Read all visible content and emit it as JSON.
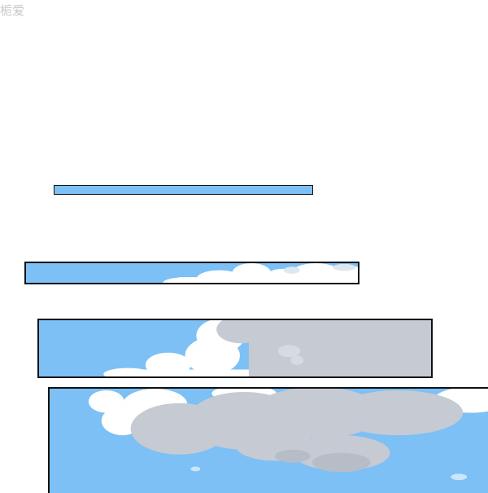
{
  "watermark": {
    "text": "栀爱"
  },
  "panels": [
    {
      "name": "sky-strip-thin"
    },
    {
      "name": "sky-strip-clouds-small"
    },
    {
      "name": "sky-strip-clouds-large"
    },
    {
      "name": "sky-strip-clouds-full"
    }
  ],
  "colors": {
    "sky": "#7cc0f5",
    "cloud_white": "#ffffff",
    "cloud_grey": "#c5cad3",
    "border": "#111111",
    "watermark": "#c9c9c9"
  }
}
